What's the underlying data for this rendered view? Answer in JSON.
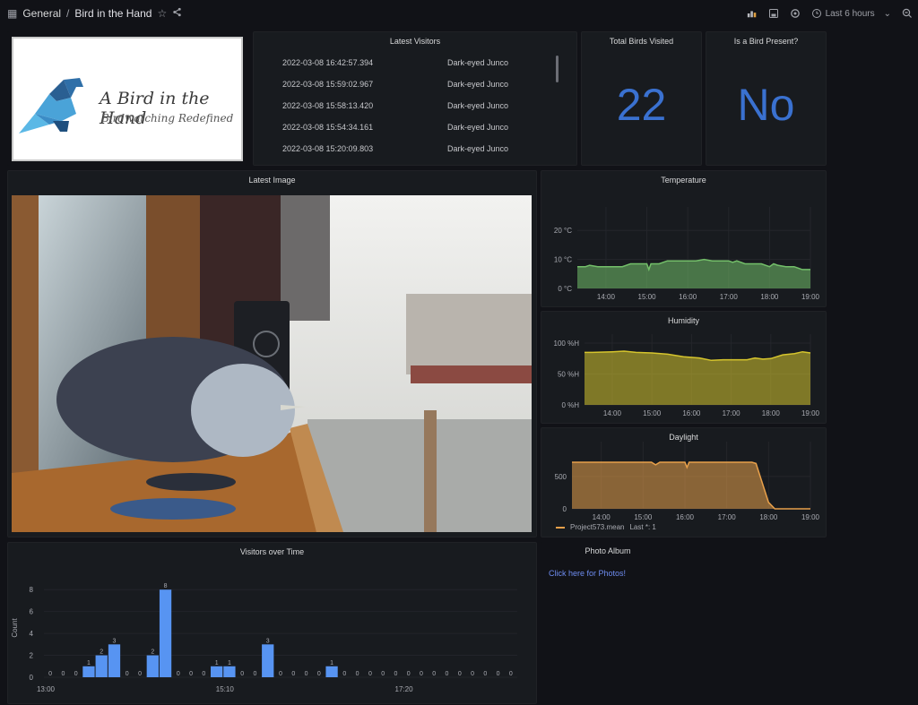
{
  "topbar": {
    "section": "General",
    "separator": "/",
    "title": "Bird in the Hand",
    "time_range": "Last 6 hours"
  },
  "logo": {
    "title": "A Bird in the Hand",
    "subtitle": "Birdwatching Redefined"
  },
  "latest_visitors": {
    "title": "Latest Visitors",
    "rows": [
      {
        "time": "2022-03-08 16:42:57.394",
        "species": "Dark-eyed Junco"
      },
      {
        "time": "2022-03-08 15:59:02.967",
        "species": "Dark-eyed Junco"
      },
      {
        "time": "2022-03-08 15:58:13.420",
        "species": "Dark-eyed Junco"
      },
      {
        "time": "2022-03-08 15:54:34.161",
        "species": "Dark-eyed Junco"
      },
      {
        "time": "2022-03-08 15:20:09.803",
        "species": "Dark-eyed Junco"
      }
    ]
  },
  "total_birds": {
    "title": "Total Birds Visited",
    "value": "22",
    "color": "#3a71d0"
  },
  "bird_present": {
    "title": "Is a Bird Present?",
    "value": "No",
    "color": "#3a71d0"
  },
  "latest_image": {
    "title": "Latest Image"
  },
  "photo_album": {
    "title": "Photo Album",
    "link": "Click here for Photos!"
  },
  "chart_data": [
    {
      "type": "area",
      "title": "Temperature",
      "unit": "°C",
      "yticks": [
        "0 °C",
        "10 °C",
        "20 °C"
      ],
      "ylim": [
        0,
        25
      ],
      "xticks": [
        "14:00",
        "15:00",
        "16:00",
        "17:00",
        "18:00",
        "19:00"
      ],
      "x": [
        13.3,
        13.5,
        13.6,
        13.8,
        14.0,
        14.2,
        14.4,
        14.6,
        14.8,
        15.0,
        15.05,
        15.1,
        15.3,
        15.5,
        15.8,
        16.0,
        16.2,
        16.4,
        16.6,
        16.8,
        17.0,
        17.1,
        17.2,
        17.4,
        17.6,
        17.8,
        18.0,
        18.1,
        18.2,
        18.4,
        18.6,
        18.8,
        19.0
      ],
      "values": [
        7.5,
        7.5,
        8,
        7.5,
        7.5,
        7.5,
        7.5,
        8.5,
        8.5,
        8.5,
        6.5,
        8.5,
        8.5,
        9.5,
        9.5,
        9.5,
        9.5,
        10,
        9.5,
        9.5,
        9.5,
        9,
        9.5,
        8.5,
        8.5,
        8.5,
        7.5,
        8.5,
        8,
        7.5,
        7.5,
        6.5,
        6.5
      ],
      "color": "#73bf69"
    },
    {
      "type": "area",
      "title": "Humidity",
      "unit": "%H",
      "yticks": [
        "0 %H",
        "50 %H",
        "100 %H"
      ],
      "ylim": [
        0,
        100
      ],
      "xticks": [
        "14:00",
        "15:00",
        "16:00",
        "17:00",
        "18:00",
        "19:00"
      ],
      "x": [
        13.0,
        13.5,
        14.0,
        14.3,
        14.6,
        15.0,
        15.4,
        15.8,
        16.2,
        16.5,
        16.8,
        17.1,
        17.4,
        17.6,
        17.8,
        18.0,
        18.3,
        18.6,
        18.8,
        19.0
      ],
      "values": [
        85,
        85,
        86,
        87,
        85,
        84,
        82,
        78,
        76,
        72,
        73,
        73,
        73,
        76,
        74,
        75,
        81,
        83,
        86,
        84
      ],
      "color": "#d6c52d"
    },
    {
      "type": "area",
      "title": "Daylight",
      "yticks": [
        "0",
        "500"
      ],
      "ylim": [
        0,
        900
      ],
      "xticks": [
        "14:00",
        "15:00",
        "16:00",
        "17:00",
        "18:00",
        "19:00"
      ],
      "x": [
        13.0,
        15.2,
        15.3,
        15.4,
        16.0,
        16.05,
        16.1,
        17.6,
        17.7,
        17.85,
        18.0,
        18.15,
        19.0
      ],
      "values": [
        720,
        720,
        680,
        720,
        720,
        640,
        720,
        720,
        700,
        400,
        100,
        0,
        0
      ],
      "legend": "Project573.mean",
      "legend_stat": "Last *: 1",
      "color": "#e8a04a"
    },
    {
      "type": "bar",
      "title": "Visitors over Time",
      "ylabel": "Count",
      "yticks": [
        "0",
        "2",
        "4",
        "6",
        "8"
      ],
      "ylim": [
        0,
        9
      ],
      "xticks": [
        "13:00",
        "15:10",
        "17:20"
      ],
      "values": [
        0,
        0,
        0,
        1,
        2,
        3,
        0,
        0,
        2,
        8,
        0,
        0,
        0,
        1,
        1,
        0,
        0,
        3,
        0,
        0,
        0,
        0,
        1,
        0,
        0,
        0,
        0,
        0,
        0,
        0,
        0,
        0,
        0,
        0,
        0,
        0,
        0
      ],
      "color": "#5794f2"
    }
  ]
}
